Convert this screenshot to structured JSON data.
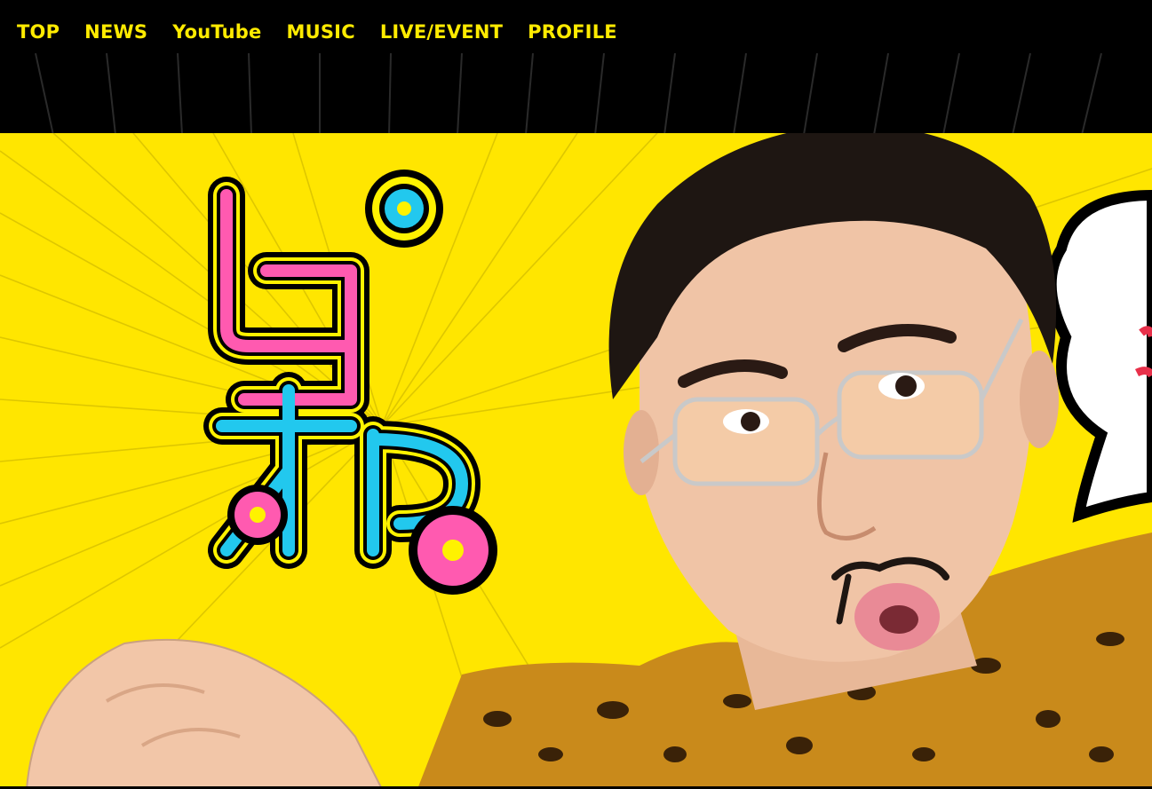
{
  "nav": {
    "items": [
      {
        "label": "TOP"
      },
      {
        "label": "NEWS"
      },
      {
        "label": "YouTube"
      },
      {
        "label": "MUSIC"
      },
      {
        "label": "LIVE/EVENT"
      },
      {
        "label": "PROFILE"
      }
    ],
    "color": "#ffeb00",
    "background": "#000000"
  },
  "hero": {
    "background": "#ffe600",
    "logo_text": "ピコ太郎",
    "logo_colors": {
      "pink": "#ff5ab0",
      "cyan": "#22c8ee",
      "outline_yellow": "#fff200",
      "outline_black": "#000000"
    },
    "character": "man with glasses and leopard-print outfit"
  }
}
